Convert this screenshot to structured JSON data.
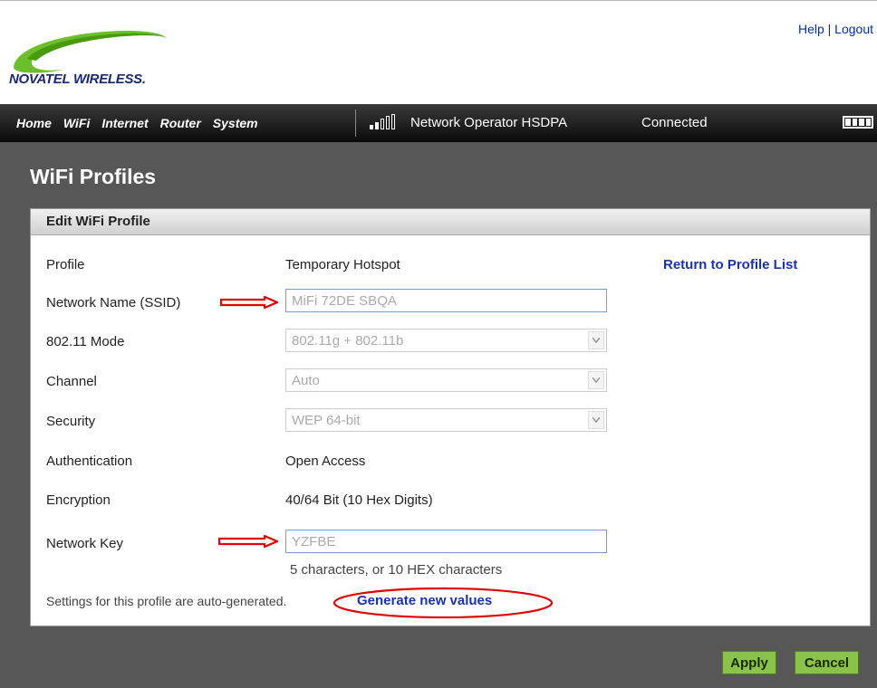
{
  "header": {
    "brand": "NOVATEL WIRELESS.",
    "links": [
      "Help",
      "Logout"
    ],
    "link_separator": "|"
  },
  "nav": {
    "items": [
      "Home",
      "WiFi",
      "Internet",
      "Router",
      "System"
    ],
    "signal_bars": 4,
    "signal_bars_filled": 2,
    "operator": "Network Operator  HSDPA",
    "status": "Connected",
    "battery_level": 1.0
  },
  "page": {
    "title": "WiFi Profiles"
  },
  "form": {
    "header": "Edit WiFi Profile",
    "return_link": "Return to Profile List",
    "profile_label": "Profile",
    "profile_value": "Temporary Hotspot",
    "ssid_label": "Network Name (SSID)",
    "ssid_value": "MiFi 72DE SBQA",
    "mode_label": "802.11 Mode",
    "mode_value": "802.11g + 802.11b",
    "channel_label": "Channel",
    "channel_value": "Auto",
    "security_label": "Security",
    "security_value": "WEP 64-bit",
    "auth_label": "Authentication",
    "auth_value": "Open Access",
    "encryption_label": "Encryption",
    "encryption_value": "40/64 Bit (10 Hex Digits)",
    "key_label": "Network Key",
    "key_value": "YZFBE",
    "key_hint": "5 characters, or 10 HEX characters",
    "autogen_text": "Settings for this profile are auto-generated.",
    "generate_link": "Generate new values"
  },
  "buttons": {
    "apply": "Apply",
    "cancel": "Cancel"
  },
  "colors": {
    "annotation": "#e00000",
    "button_green": "#8bc34a",
    "link_blue": "#1a33aa"
  }
}
